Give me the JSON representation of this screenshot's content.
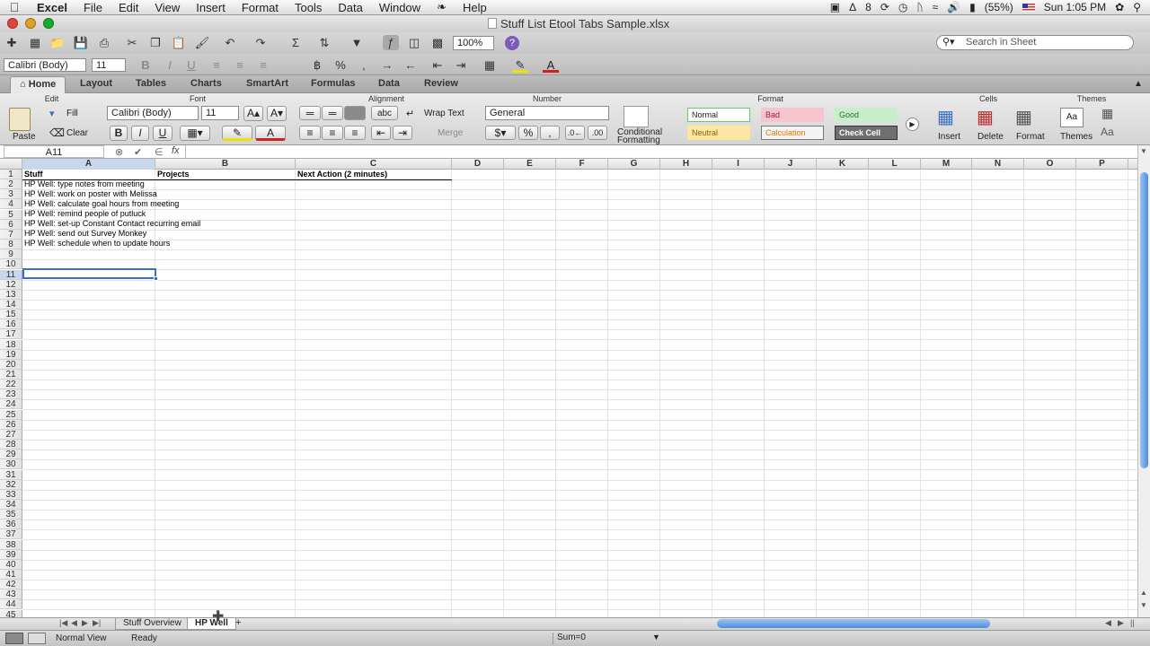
{
  "menubar": {
    "app": "Excel",
    "items": [
      "File",
      "Edit",
      "View",
      "Insert",
      "Format",
      "Tools",
      "Data",
      "Window",
      "Help"
    ],
    "adobe_count": "8",
    "battery": "(55%)",
    "clock": "Sun 1:05 PM"
  },
  "window": {
    "title": "Stuff List Etool Tabs Sample.xlsx"
  },
  "toolbar": {
    "zoom": "100%",
    "search_placeholder": "Search in Sheet"
  },
  "format_bar": {
    "font": "Calibri (Body)",
    "size": "11"
  },
  "ribbon_tabs": [
    "Home",
    "Layout",
    "Tables",
    "Charts",
    "SmartArt",
    "Formulas",
    "Data",
    "Review"
  ],
  "ribbon": {
    "groups": {
      "edit": "Edit",
      "font": "Font",
      "alignment": "Alignment",
      "number": "Number",
      "format": "Format",
      "cells": "Cells",
      "themes": "Themes"
    },
    "paste": "Paste",
    "fill": "Fill",
    "clear": "Clear",
    "font": "Calibri (Body)",
    "size": "11",
    "abc": "abc",
    "wrap_text": "Wrap Text",
    "merge": "Merge",
    "number_format": "General",
    "conditional": "Conditional",
    "formatting": "Formatting",
    "styles": {
      "normal": "Normal",
      "bad": "Bad",
      "good": "Good",
      "neutral": "Neutral",
      "calculation": "Calculation",
      "check_cell": "Check Cell"
    },
    "insert": "Insert",
    "delete": "Delete",
    "format_btn": "Format",
    "themes_btn": "Themes"
  },
  "formula_bar": {
    "name_box": "A11",
    "fx": "fx",
    "content": ""
  },
  "columns": [
    "A",
    "B",
    "C",
    "D",
    "E",
    "F",
    "G",
    "H",
    "I",
    "J",
    "K",
    "L",
    "M",
    "N",
    "O",
    "P"
  ],
  "rows": [
    "1",
    "2",
    "3",
    "4",
    "5",
    "6",
    "7",
    "8",
    "9",
    "10",
    "11",
    "12",
    "13",
    "14",
    "15",
    "16",
    "17",
    "18",
    "19",
    "20",
    "21",
    "22",
    "23",
    "24",
    "25",
    "26",
    "27",
    "28",
    "29",
    "30",
    "31",
    "32",
    "33",
    "34",
    "35",
    "36",
    "37",
    "38",
    "39",
    "40",
    "41",
    "42",
    "43",
    "44",
    "45"
  ],
  "sheet": {
    "headers": {
      "a1": "Stuff",
      "b1": "Projects",
      "c1": "Next Action (2 minutes)"
    },
    "items": [
      "HP Well: type notes from meeting",
      "HP Well: work on poster with Melissa",
      "HP Well: calculate goal hours from meeting",
      "HP Well: remind people of putluck",
      "HP Well: set-up Constant Contact recurring email",
      "HP Well: send out Survey Monkey",
      "HP Well: schedule when to update hours"
    ]
  },
  "sheet_tabs": [
    "Stuff Overview",
    "HP Well"
  ],
  "statusbar": {
    "view": "Normal View",
    "state": "Ready",
    "sum": "Sum=0"
  }
}
